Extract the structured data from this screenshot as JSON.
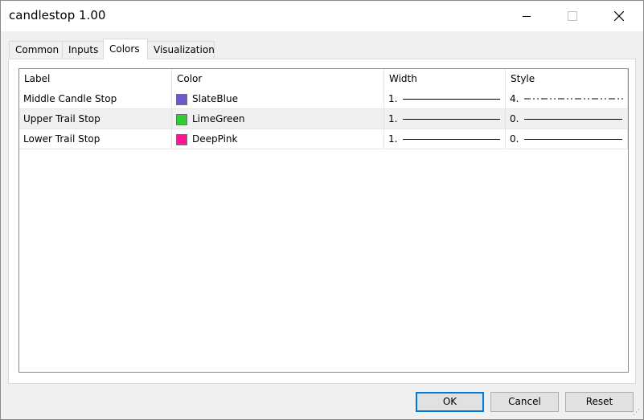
{
  "window": {
    "title": "candlestop 1.00"
  },
  "tabs": [
    {
      "label": "Common"
    },
    {
      "label": "Inputs"
    },
    {
      "label": "Colors"
    },
    {
      "label": "Visualization"
    }
  ],
  "table": {
    "headers": {
      "label": "Label",
      "color": "Color",
      "width": "Width",
      "style": "Style"
    },
    "rows": [
      {
        "label": "Middle Candle Stop",
        "color_name": "SlateBlue",
        "color_hex": "#6a5acd",
        "width": "1.",
        "style": "4."
      },
      {
        "label": "Upper Trail Stop",
        "color_name": "LimeGreen",
        "color_hex": "#32cd32",
        "width": "1.",
        "style": "0."
      },
      {
        "label": "Lower Trail Stop",
        "color_name": "DeepPink",
        "color_hex": "#ff1493",
        "width": "1.",
        "style": "0."
      }
    ]
  },
  "buttons": {
    "ok": "OK",
    "cancel": "Cancel",
    "reset": "Reset"
  }
}
